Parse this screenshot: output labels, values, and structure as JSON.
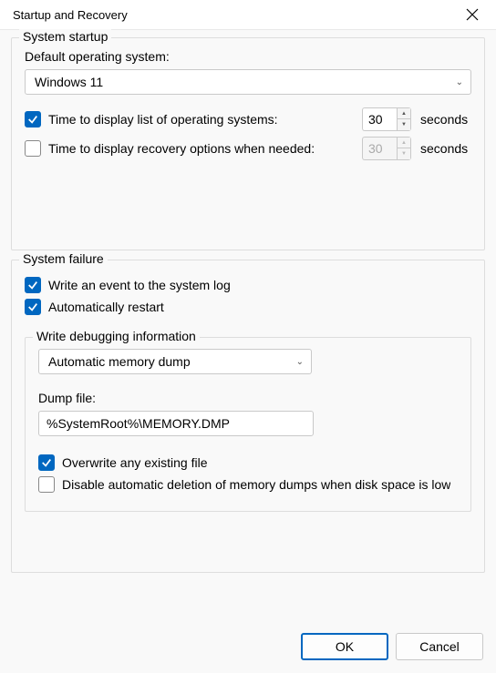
{
  "window": {
    "title": "Startup and Recovery"
  },
  "startup": {
    "group_title": "System startup",
    "default_os_label": "Default operating system:",
    "default_os_value": "Windows 11",
    "time_os_list": {
      "checked": true,
      "label": "Time to display list of operating systems:",
      "value": "30",
      "suffix": "seconds"
    },
    "time_recovery": {
      "checked": false,
      "label": "Time to display recovery options when needed:",
      "value": "30",
      "suffix": "seconds"
    }
  },
  "failure": {
    "group_title": "System failure",
    "write_event": {
      "checked": true,
      "label": "Write an event to the system log"
    },
    "auto_restart": {
      "checked": true,
      "label": "Automatically restart"
    },
    "debug": {
      "group_title": "Write debugging information",
      "dump_type": "Automatic memory dump",
      "dump_file_label": "Dump file:",
      "dump_file_value": "%SystemRoot%\\MEMORY.DMP",
      "overwrite": {
        "checked": true,
        "label": "Overwrite any existing file"
      },
      "disable_auto_delete": {
        "checked": false,
        "label": "Disable automatic deletion of memory dumps when disk space is low"
      }
    }
  },
  "buttons": {
    "ok": "OK",
    "cancel": "Cancel"
  }
}
